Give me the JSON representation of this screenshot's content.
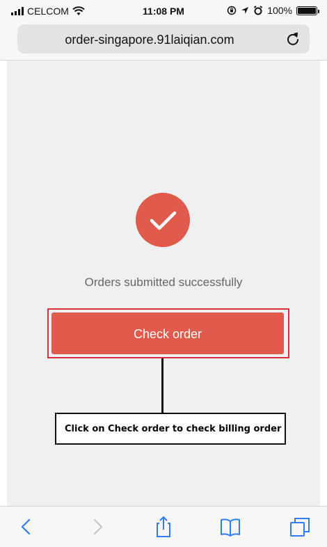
{
  "status_bar": {
    "carrier": "CELCOM",
    "time": "11:08 PM",
    "battery": "100%",
    "battery_level": 1.0,
    "signal_bars": 4
  },
  "browser": {
    "url": "order-singapore.91laiqian.com"
  },
  "main": {
    "success_message": "Orders submitted successfully",
    "check_order_label": "Check order"
  },
  "annotation": {
    "text": "Click on Check order to check billing order"
  },
  "colors": {
    "accent": "#e15b4d",
    "highlight_border": "#d9303b",
    "toolbar_icon": "#2f7cf6",
    "toolbar_icon_disabled": "#c5c5c8"
  },
  "icons": {
    "status": [
      "signal-icon",
      "wifi-icon",
      "lock-rotation-icon",
      "location-icon",
      "alarm-icon",
      "battery-icon"
    ],
    "toolbar": [
      "back-icon",
      "forward-icon",
      "share-icon",
      "bookmarks-icon",
      "tabs-icon"
    ],
    "url": "reload-icon",
    "success": "checkmark-icon"
  }
}
